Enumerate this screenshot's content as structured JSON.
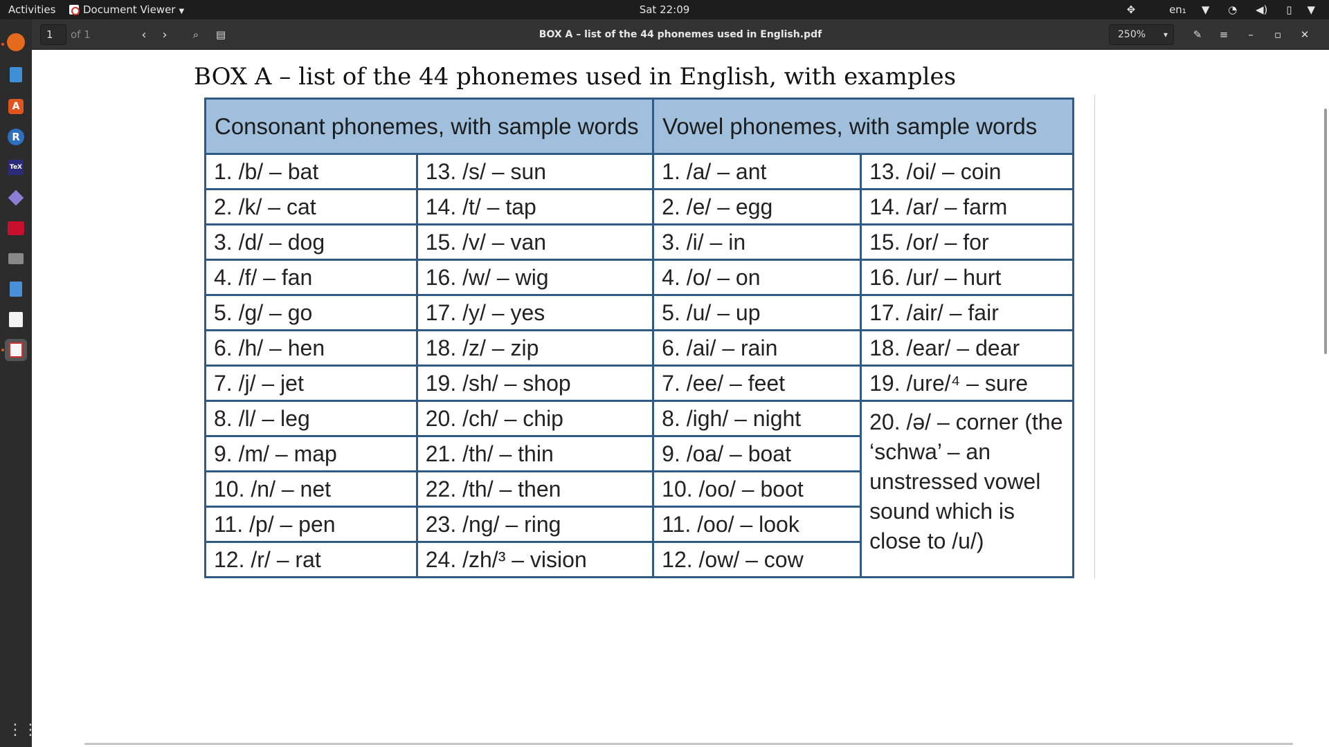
{
  "topbar": {
    "activities": "Activities",
    "app_menu": "Document Viewer",
    "clock": "Sat 22:09",
    "lang": "en₁"
  },
  "headerbar": {
    "page_number": "1",
    "page_of": "of 1",
    "doc_title": "BOX A – list of the 44 phonemes used in English.pdf",
    "zoom": "250%"
  },
  "document": {
    "title": "BOX A – list of the 44 phonemes used in English, with examples",
    "table": {
      "headers": [
        "Consonant phonemes, with sample words",
        "Vowel phonemes, with sample words"
      ],
      "rows": [
        [
          "1. /b/ – bat",
          "13. /s/ – sun",
          "1.   /a/ – ant",
          "13. /oi/ – coin"
        ],
        [
          "2. /k/ – cat",
          "14. /t/ – tap",
          "2.   /e/ – egg",
          "14. /ar/ – farm"
        ],
        [
          "3. /d/ – dog",
          "15. /v/ – van",
          "3.   /i/ – in",
          "15. /or/ – for"
        ],
        [
          "4. /f/ – fan",
          "16. /w/ – wig",
          "4.   /o/ – on",
          "16. /ur/ – hurt"
        ],
        [
          "5. /g/ – go",
          "17. /y/ – yes",
          "5.   /u/ – up",
          "17. /air/ – fair"
        ],
        [
          "6. /h/ – hen",
          "18. /z/ – zip",
          "6.   /ai/ – rain",
          "18. /ear/ – dear"
        ],
        [
          "7. /j/ – jet",
          "19. /sh/ – shop",
          "7.   /ee/ – feet",
          "19. /ure/⁴ – sure"
        ],
        [
          "8. /l/ – leg",
          "20. /ch/ – chip",
          "8.   /igh/ – night"
        ],
        [
          "9. /m/ – map",
          "21. /th/ – thin",
          "9.   /oa/ – boat"
        ],
        [
          "10. /n/ – net",
          "22. /th/ – then",
          "10. /oo/ – boot"
        ],
        [
          "11. /p/ – pen",
          "23. /ng/ – ring",
          "11. /oo/ – look"
        ],
        [
          "12. /r/ – rat",
          "24. /zh/³ – vision",
          "12. /ow/ – cow"
        ]
      ],
      "schwa": "20. /ə/ – corner (the ‘schwa’ – an unstressed vowel sound which is close to /u/)"
    }
  }
}
